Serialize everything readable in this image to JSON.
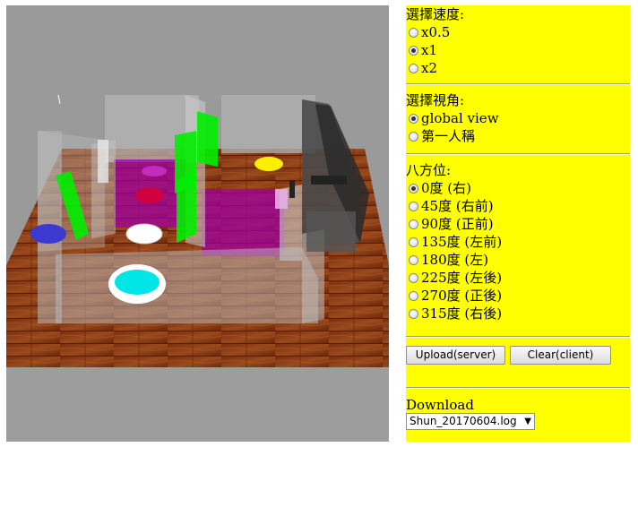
{
  "speed": {
    "heading": "選擇速度:",
    "options": [
      {
        "label": "x0.5",
        "checked": false
      },
      {
        "label": "x1",
        "checked": true
      },
      {
        "label": "x2",
        "checked": false
      }
    ]
  },
  "view": {
    "heading": "選擇視角:",
    "options": [
      {
        "label": "global view",
        "checked": true
      },
      {
        "label": "第一人稱",
        "checked": false
      }
    ]
  },
  "direction": {
    "heading": "八方位:",
    "options": [
      {
        "label": "0度 (右)",
        "checked": true
      },
      {
        "label": "45度 (右前)",
        "checked": false
      },
      {
        "label": "90度 (正前)",
        "checked": false
      },
      {
        "label": "135度 (左前)",
        "checked": false
      },
      {
        "label": "180度 (左)",
        "checked": false
      },
      {
        "label": "225度 (左後)",
        "checked": false
      },
      {
        "label": "270度 (正後)",
        "checked": false
      },
      {
        "label": "315度 (右後)",
        "checked": false
      }
    ]
  },
  "buttons": {
    "upload": "Upload(server)",
    "clear": "Clear(client)"
  },
  "download": {
    "label": "Download",
    "selected": "Shun_20170604.log",
    "arrow": "▼"
  },
  "colors": {
    "panel": "#ffff00",
    "floor": "#8a3a14",
    "viewport_bg": "#9a9a9a",
    "marker_cyan": "#00e5e5",
    "marker_blue": "#3a3ad0",
    "marker_yellow": "#ffee00",
    "marker_red": "#d00040",
    "panel_green": "#00ee00",
    "rug_purple": "#a000a0"
  }
}
